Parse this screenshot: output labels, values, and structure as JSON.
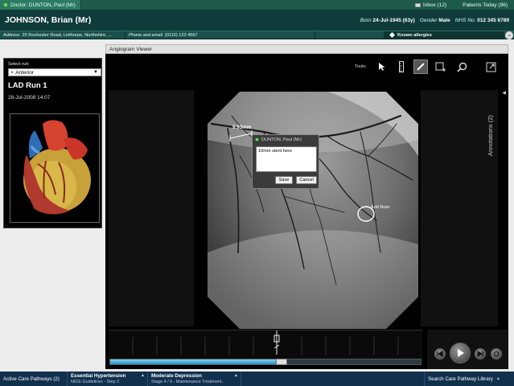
{
  "topbar": {
    "doctor": "Doctor: DUNTON, Paul (Mr)",
    "inbox": "Inbox (12)",
    "patients_today": "Patients Today (96)"
  },
  "patient": {
    "name": "JOHNSON, Brian (Mr)",
    "born_label": "Born",
    "born_value": "24-Jul-1945 (63y)",
    "gender_label": "Gender",
    "gender_value": "Male",
    "nhs_label": "NHS No.",
    "nhs_value": "012 345 6789"
  },
  "addressbar": {
    "address_label": "Address",
    "address_value": "25 Rochester Road, Linthorpe, Northshire, ...",
    "phone_label": "Phone and email",
    "phone_value": "(0116) 123 4567",
    "allergies": "Known allergies"
  },
  "leftpanel": {
    "select_label": "Select run:",
    "selected_run": "Anterior",
    "run_title": "LAD Run 1",
    "run_date": "28-Jul-2008 14:07"
  },
  "viewer": {
    "title": "Angiogram Viewer",
    "tools_label": "Tools:",
    "annotations_tab": "Annotations (2)",
    "measurement": "9.93mm",
    "add_note": "Add Note",
    "playback_progress_percent": 57
  },
  "note_popup": {
    "author": "DUNTON, Paul (Mr)",
    "text": "10mm stent here",
    "save": "Save",
    "cancel": "Cancel"
  },
  "bottombar": {
    "active_pathways": "Active Care Pathways (2)",
    "pathway1_title": "Essential Hypertension",
    "pathway1_sub": "NICE Guidelines - Step 2",
    "pathway2_title": "Moderate Depression",
    "pathway2_sub": "Stage 4 / 6 - Maintenance Treatment...",
    "search": "Search Care Pathway Library"
  }
}
